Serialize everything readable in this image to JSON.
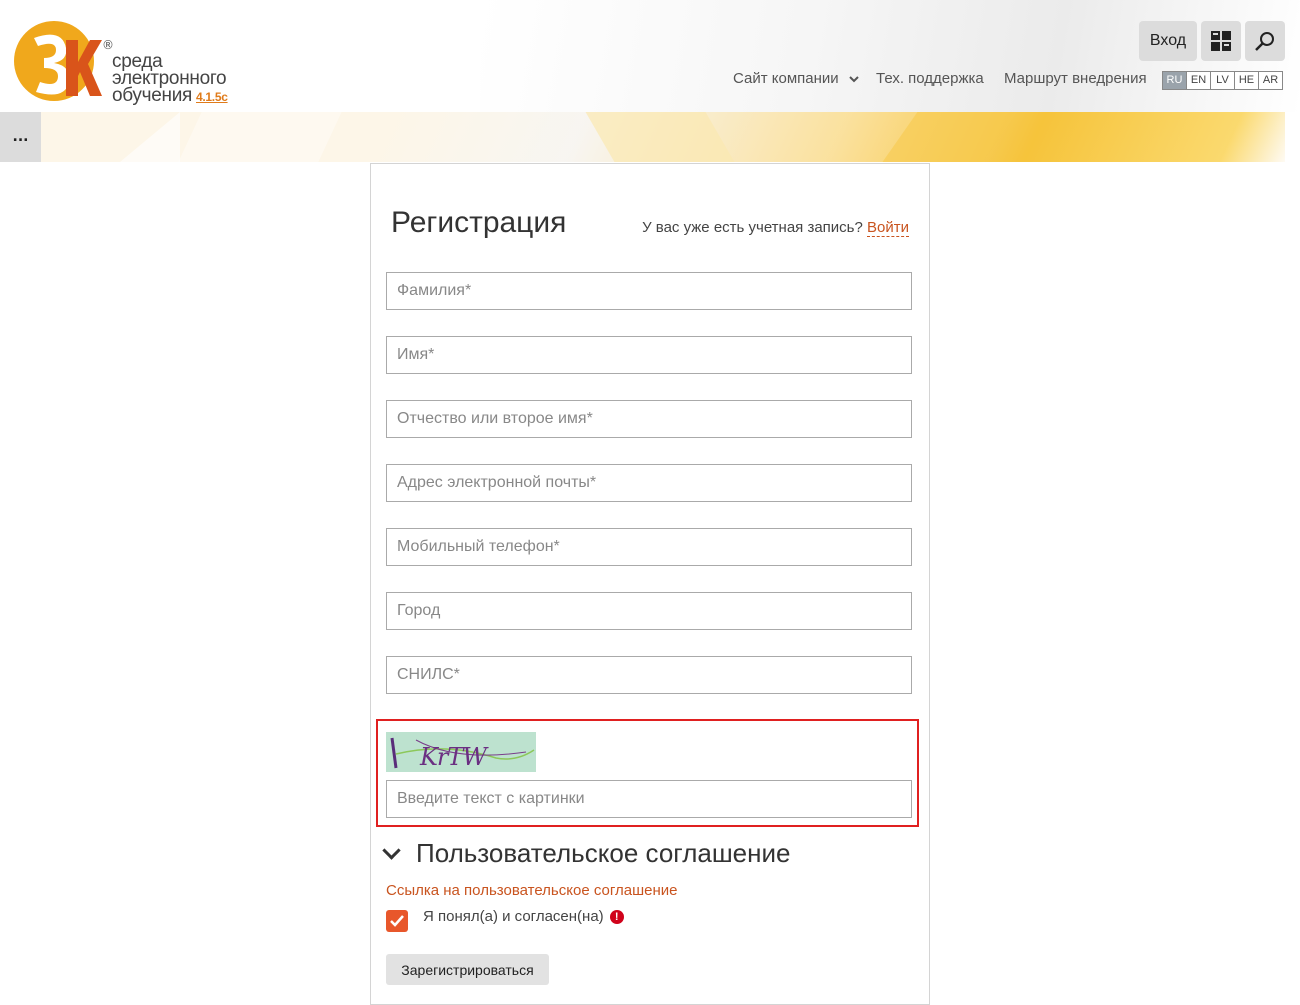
{
  "logo": {
    "line1": "среда",
    "line2": "электронного",
    "line3": "обучения",
    "version": "4.1.5c",
    "registered": "®"
  },
  "header": {
    "login_label": "Вход",
    "nav": [
      {
        "label": "Сайт компании",
        "icon": "chevron-down-icon"
      },
      {
        "label": "Тех. поддержка"
      },
      {
        "label": "Маршрут внедрения"
      }
    ],
    "languages": [
      "RU",
      "EN",
      "LV",
      "HE",
      "AR"
    ],
    "selected_language": "RU"
  },
  "sidebar_toggle": {
    "label": "..."
  },
  "form": {
    "title": "Регистрация",
    "have_account_text": "У вас уже есть учетная запись?",
    "login_link": "Войти",
    "fields": [
      {
        "placeholder": "Фамилия*",
        "value": ""
      },
      {
        "placeholder": "Имя*",
        "value": ""
      },
      {
        "placeholder": "Отчество или второе имя*",
        "value": ""
      },
      {
        "placeholder": "Адрес электронной почты*",
        "value": ""
      },
      {
        "placeholder": "Мобильный телефон*",
        "value": ""
      },
      {
        "placeholder": "Город",
        "value": ""
      },
      {
        "placeholder": "СНИЛС*",
        "value": ""
      }
    ],
    "captcha": {
      "image_text": "KrTW",
      "placeholder": "Введите текст с картинки",
      "value": ""
    },
    "agreement": {
      "heading": "Пользовательское соглашение",
      "link": "Ссылка на пользовательское соглашение",
      "checkbox_label": "Я понял(а) и согласен(на)",
      "checked": true
    },
    "submit_label": "Зарегистрироваться"
  },
  "colors": {
    "accent": "#e8572b",
    "link": "#c9541f",
    "error": "#d0021b",
    "highlight_border": "#e02020"
  }
}
